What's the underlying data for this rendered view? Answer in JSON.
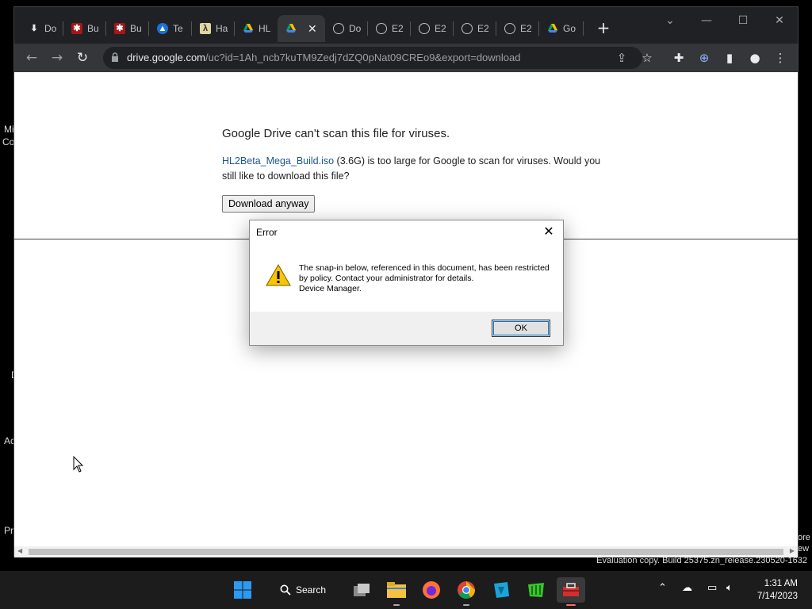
{
  "desktop": {
    "fragments": [
      "Mi",
      "Co",
      "D",
      "Ac",
      "Pr",
      "ore",
      "ew"
    ]
  },
  "browser": {
    "tabs": [
      {
        "label": "Do",
        "icon": "download-icon"
      },
      {
        "label": "Bu",
        "icon": "bug-icon"
      },
      {
        "label": "Bu",
        "icon": "bug-icon"
      },
      {
        "label": "Te",
        "icon": "site-icon"
      },
      {
        "label": "Ha",
        "icon": "lambda-icon"
      },
      {
        "label": "HL",
        "icon": "google-drive-icon"
      },
      {
        "label": "",
        "icon": "google-drive-icon"
      },
      {
        "label": "Do",
        "icon": "globe-icon"
      },
      {
        "label": "E2",
        "icon": "globe-icon"
      },
      {
        "label": "E2",
        "icon": "globe-icon"
      },
      {
        "label": "E2",
        "icon": "globe-icon"
      },
      {
        "label": "E2",
        "icon": "globe-icon"
      },
      {
        "label": "Go",
        "icon": "google-drive-icon"
      }
    ],
    "address": {
      "host": "drive.google.com",
      "path": "/uc?id=1Ah_ncb7kuTM9Zedj7dZQ0pNat09CREo9&export=download"
    }
  },
  "page": {
    "title": "Google Drive can't scan this file for viruses.",
    "file_link": "HL2Beta_Mega_Build.iso",
    "message_rest": " (3.6G) is too large for Google to scan for viruses. Would you still like to download this file?",
    "download_button": "Download anyway"
  },
  "dialog": {
    "title": "Error",
    "line1": "The snap-in below, referenced in this document, has been restricted by policy. Contact your administrator for details.",
    "line2": "Device Manager.",
    "ok_label": "OK"
  },
  "watermark": "Evaluation copy. Build 25375.zn_release.230520-1632",
  "taskbar": {
    "search_label": "Search",
    "time": "1:31 AM",
    "date": "7/14/2023"
  },
  "colors": {
    "chrome_dark": "#202124",
    "chrome_toolbar": "#35363a",
    "link": "#1a5494",
    "taskbar": "#1c1c1c"
  }
}
